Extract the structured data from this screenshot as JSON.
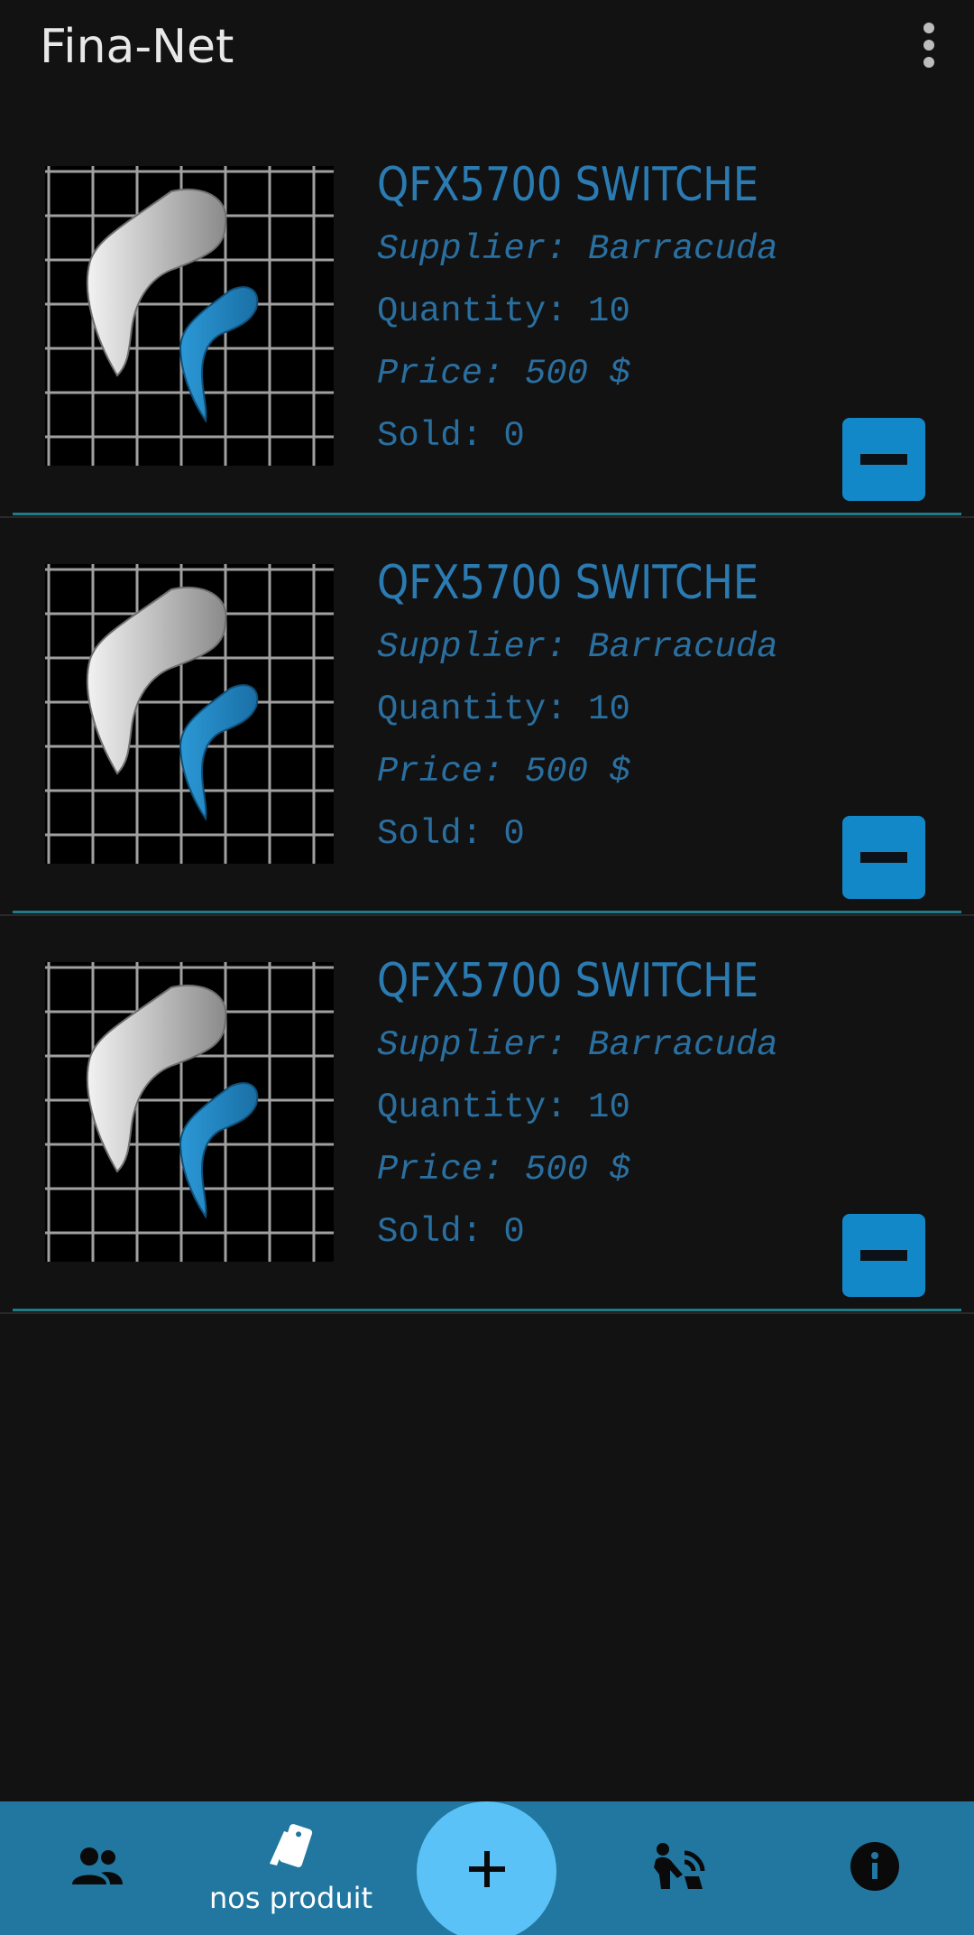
{
  "app": {
    "title": "Fina-Net"
  },
  "products": [
    {
      "name": "QFX5700 SWITCHE",
      "supplier": "Supplier: Barracuda",
      "quantity": "Quantity: 10",
      "price": "Price: 500 $",
      "sold": "Sold: 0"
    },
    {
      "name": "QFX5700 SWITCHE",
      "supplier": "Supplier: Barracuda",
      "quantity": "Quantity: 10",
      "price": "Price: 500 $",
      "sold": "Sold: 0"
    },
    {
      "name": "QFX5700 SWITCHE",
      "supplier": "Supplier: Barracuda",
      "quantity": "Quantity: 10",
      "price": "Price: 500 $",
      "sold": "Sold: 0"
    }
  ],
  "bottom_nav": {
    "items": [
      {
        "icon": "people-icon",
        "label": ""
      },
      {
        "icon": "products-icon",
        "label": "nos produit"
      },
      {
        "icon": "add-icon",
        "label": ""
      },
      {
        "icon": "wifi-user-icon",
        "label": ""
      },
      {
        "icon": "info-icon",
        "label": ""
      }
    ]
  },
  "colors": {
    "background": "#121212",
    "accent_text": "#2b7bb3",
    "button": "#1288c9",
    "nav_bar": "#2177a0",
    "fab": "#5bc2f7",
    "divider": "#1f7b86"
  }
}
